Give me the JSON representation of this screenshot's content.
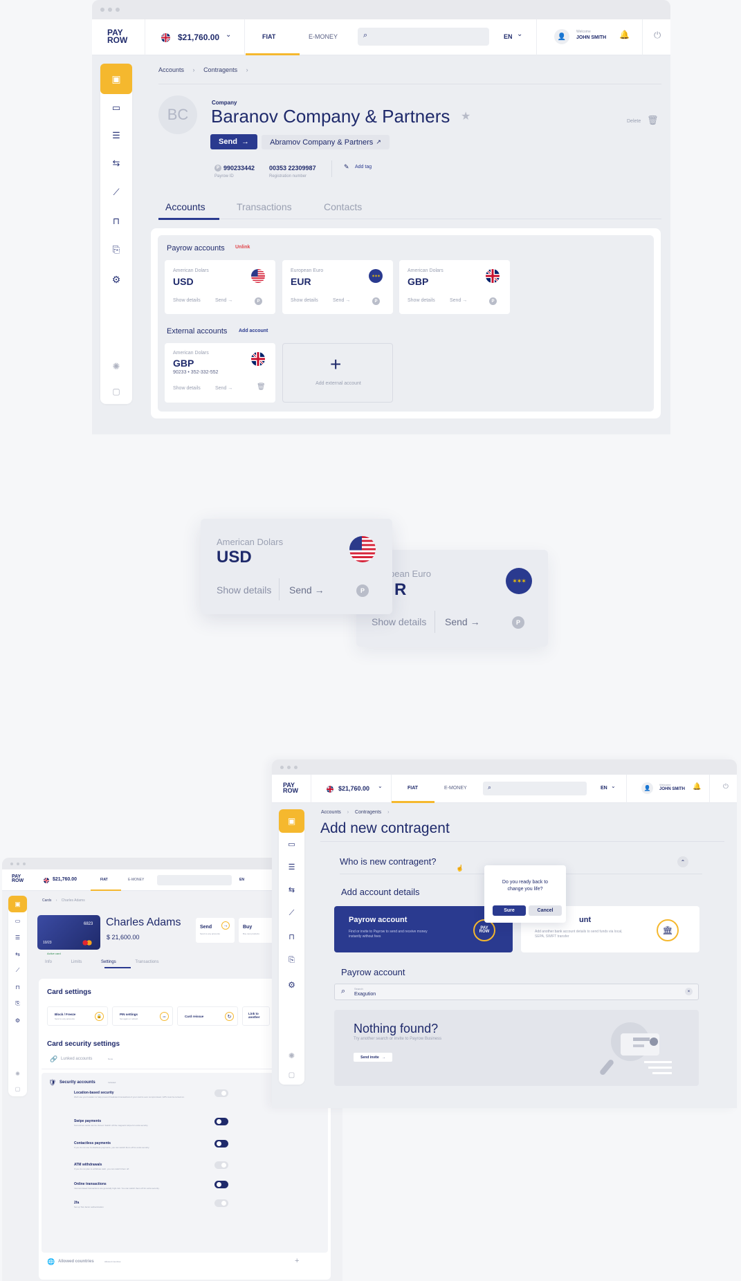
{
  "colors": {
    "brand": "#1f2a6b",
    "accent": "#f5b82e",
    "primary": "#2a3a8f",
    "danger": "#e0474c",
    "bg": "#eceef2"
  },
  "w1": {
    "logo": [
      "PAY",
      "ROW"
    ],
    "balance": "$21,760.00",
    "tabs": [
      "FIAT",
      "E-MONEY"
    ],
    "lang": "EN",
    "welcome": "Welcome",
    "user": "JOHN SMITH",
    "breadcrumb": [
      "Accounts",
      "Contragents"
    ],
    "avatar": "BC",
    "company_label": "Company",
    "company_name": "Baranov Company & Partners",
    "send": "Send",
    "linked": "Abramov Company & Partners",
    "delete": "Delete",
    "payrow_id": "990233442",
    "payrow_id_label": "Payrow ID",
    "reg": "00353 22309987",
    "reg_label": "Registration number",
    "add_tag": "Add tag",
    "page_tabs": [
      "Accounts",
      "Transactions",
      "Contacts"
    ],
    "payrow_accounts": "Payrow accounts",
    "unlink": "Unlink",
    "accounts": [
      {
        "sub": "American Dolars",
        "code": "USD",
        "flag": "us-flag-icon"
      },
      {
        "sub": "European Euro",
        "code": "EUR",
        "flag": "eu-flag-icon"
      },
      {
        "sub": "American Dolars",
        "code": "GBP",
        "flag": "uk-flag-icon"
      }
    ],
    "show_details": "Show details",
    "send_small": "Send",
    "p": "P",
    "external_accounts": "External accounts",
    "add_account": "Add account",
    "external": {
      "sub": "American Dolars",
      "code": "GBP",
      "number": "90233 • 352-332-552"
    },
    "add_external": "Add external account"
  },
  "zoom": {
    "usd": {
      "sub": "American Dolars",
      "code": "USD"
    },
    "eur": {
      "sub": "pean Euro",
      "code": "R"
    },
    "show_details": "Show details",
    "send": "Send",
    "p": "P"
  },
  "w3": {
    "balance": "$21,760.00",
    "tabs": [
      "FIAT",
      "E-MONEY"
    ],
    "lang": "EN",
    "breadcrumb": [
      "Cards",
      "Charles Adams"
    ],
    "card_number": "6823",
    "card_exp": "10/23",
    "active_card": "Active card",
    "holder": "Charles Adams",
    "card_balance": "$ 21,600.00",
    "actions": [
      {
        "label": "Send",
        "hint": "Send to any accounts"
      },
      {
        "label": "Buy",
        "hint": "Buy new products"
      }
    ],
    "tabs2": [
      "Info",
      "Limits",
      "Settings",
      "Transactions"
    ],
    "card_settings": "Card settings",
    "settings": [
      {
        "label": "Block / Freeze",
        "hint": "Send to any accounts"
      },
      {
        "label": "PIN settings",
        "hint": "Set again or refresh"
      },
      {
        "label": "Card reissue",
        "hint": ""
      },
      {
        "label": "Link to another",
        "hint": ""
      }
    ],
    "security_title": "Card security settings",
    "linked_accounts": "Lunked accounts",
    "linked_count": "None",
    "security_accounts": "Security accounts",
    "security_badge": "Included",
    "toggles": [
      {
        "label": "Location-based security",
        "hint": "We'll use your location to help prevent fraudulent transactions if your card is ever compromised. GPS must be turned on.",
        "on": false
      },
      {
        "label": "Swipe payments",
        "hint": "Sometimes cards can be cloned. Switch off the magnetic stripe for extra security.",
        "on": true
      },
      {
        "label": "Contactless payments",
        "hint": "If you do not use Contactless payments, you can switch them off for extra security.",
        "on": true
      },
      {
        "label": "ATM withdrawals",
        "hint": "If you do not plan to withdraw cash, you can switch them off.",
        "on": false
      },
      {
        "label": "Online transactions",
        "hint": "Internet-based transactions are generally high-risk. You can switch them off for extra security.",
        "on": true
      },
      {
        "label": "2fa",
        "hint": "Set up Two factor authentication",
        "on": false
      }
    ],
    "allowed": "Allowed countries",
    "allowed_hint": "Allowed countries"
  },
  "w2": {
    "balance": "$21,760.00",
    "tabs": [
      "FIAT",
      "E-MONEY"
    ],
    "lang": "EN",
    "welcome": "Welcome",
    "user": "JOHN SMITH",
    "breadcrumb": [
      "Accounts",
      "Contragents"
    ],
    "title": "Add new contragent",
    "q1": "Who is new contragent?",
    "add_details": "Add account details",
    "payrow_card": {
      "title": "Payrow account",
      "desc": "Find or invite to Payrow to send and receive money instantly without fees"
    },
    "bank_card": {
      "title": "unt",
      "desc": "Add another bank account details to send funds via local, SEPA, SWIFT transfer"
    },
    "popup": {
      "text": "Do you ready back to change you life?",
      "sure": "Sure",
      "cancel": "Cancel"
    },
    "payrow_account": "Payrow account",
    "search_label": "Search",
    "search_value": "Exagution",
    "nothing": "Nothing found?",
    "nothing_hint": "Try another search or invite to Payrow Business",
    "send_invite": "Send invite"
  }
}
